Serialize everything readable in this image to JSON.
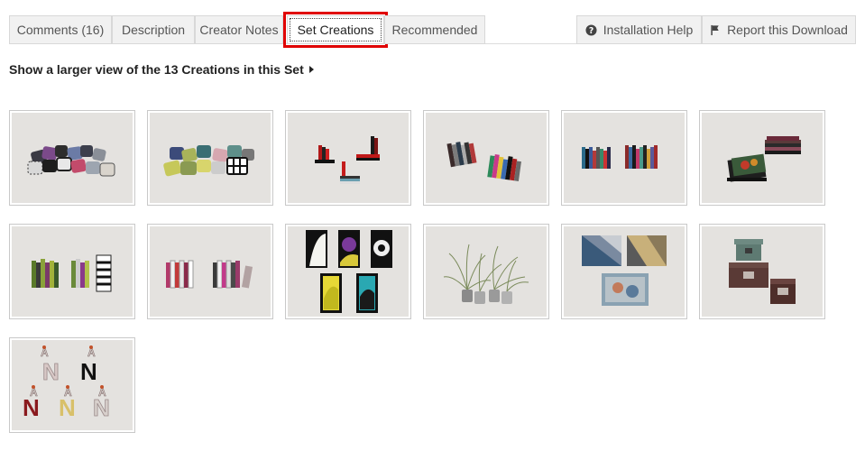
{
  "tabs": [
    {
      "label": "Comments (16)",
      "active": false
    },
    {
      "label": "Description",
      "active": false
    },
    {
      "label": "Creator Notes",
      "active": false
    },
    {
      "label": "Set Creations",
      "active": true
    },
    {
      "label": "Recommended",
      "active": false
    }
  ],
  "right_tabs": [
    {
      "label": "Installation Help",
      "icon": "question-circle-icon"
    },
    {
      "label": "Report this Download",
      "icon": "flag-icon"
    }
  ],
  "larger_view_link": "Show a larger view of the 13 Creations in this Set",
  "creations": [
    {
      "subject": "pillows-pattern"
    },
    {
      "subject": "pillows-color"
    },
    {
      "subject": "book-stacks-red"
    },
    {
      "subject": "books-leaning"
    },
    {
      "subject": "books-row"
    },
    {
      "subject": "magazine-stacks"
    },
    {
      "subject": "books-green-row"
    },
    {
      "subject": "books-pink-row"
    },
    {
      "subject": "abstract-art-frames"
    },
    {
      "subject": "grass-plants"
    },
    {
      "subject": "rug-panels"
    },
    {
      "subject": "storage-boxes"
    },
    {
      "subject": "letter-n-decor"
    }
  ],
  "colors": {
    "active_tab_highlight": "#e00000",
    "tab_bg": "#f1f1f1",
    "thumb_bg": "#e4e2df"
  }
}
